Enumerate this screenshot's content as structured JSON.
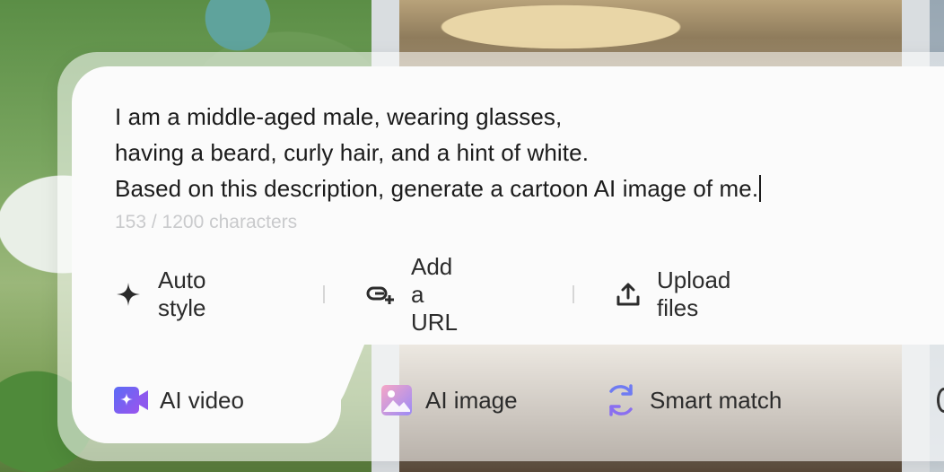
{
  "prompt": {
    "lines": [
      "I am a middle-aged male, wearing glasses,",
      "having a beard, curly hair, and a hint of white.",
      "Based on this description, generate a cartoon AI image of me."
    ],
    "char_count": "153 / 1200 characters"
  },
  "actions": [
    {
      "label": "Auto style",
      "icon": "sparkle-icon"
    },
    {
      "label": "Add a URL",
      "icon": "link-add-icon"
    },
    {
      "label": "Upload files",
      "icon": "upload-icon"
    }
  ],
  "tabs": [
    {
      "label": "AI video",
      "icon": "video-camera-icon",
      "active": true
    },
    {
      "label": "AI image",
      "icon": "image-icon",
      "active": false
    },
    {
      "label": "Smart match",
      "icon": "refresh-arrows-icon",
      "active": false
    }
  ],
  "colors": {
    "video_icon": "#6b5cf0",
    "image_icon_start": "#f2a6d0",
    "image_icon_end": "#9e8cf7",
    "smart_match_icon": "#6f7bf2"
  }
}
